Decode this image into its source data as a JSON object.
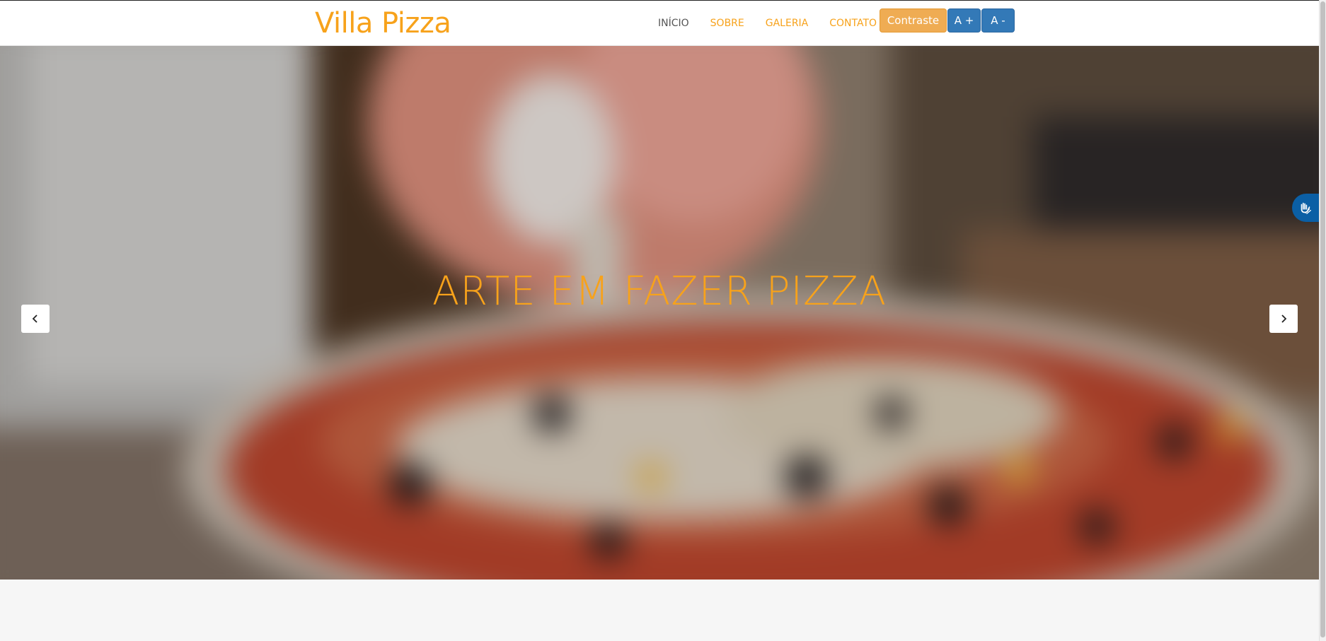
{
  "brand": {
    "name": "Villa Pizza"
  },
  "nav": {
    "items": [
      {
        "label": "INÍCIO",
        "active": true
      },
      {
        "label": "SOBRE",
        "active": false
      },
      {
        "label": "GALERIA",
        "active": false
      },
      {
        "label": "CONTATO",
        "active": false
      }
    ]
  },
  "accessibility": {
    "contrast_label": "Contraste",
    "font_increase_label": "A +",
    "font_decrease_label": "A -",
    "libras_icon": "hands-sign-language-icon"
  },
  "hero": {
    "title": "ARTE EM FAZER PIZZA",
    "prev_icon": "chevron-left-icon",
    "next_icon": "chevron-right-icon"
  },
  "colors": {
    "brand": "#f7a21b",
    "nav_active": "#555555",
    "contrast_button": "#efac53",
    "font_button": "#3379b7",
    "libras_widget": "#0b5fa5"
  }
}
